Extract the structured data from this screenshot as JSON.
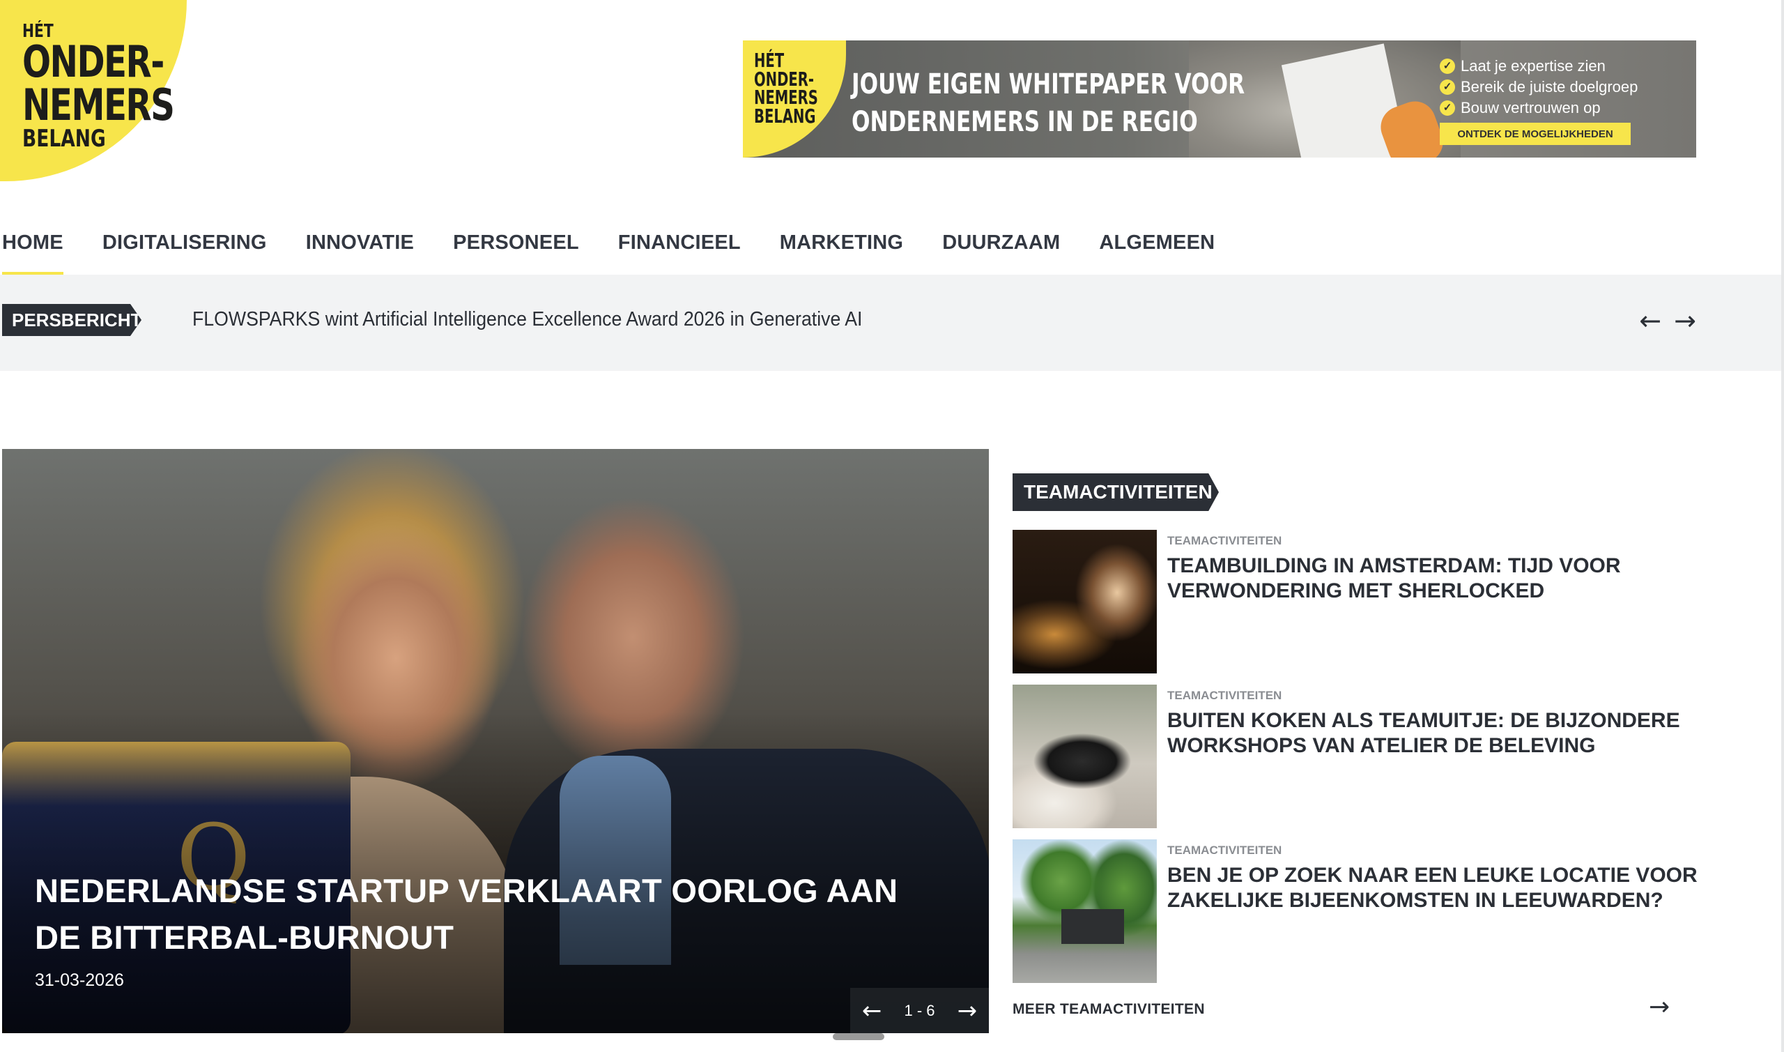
{
  "logo": {
    "line1": "HÉT",
    "line2": "ONDER-",
    "line3": "NEMERS",
    "line4": "BELANG"
  },
  "banner": {
    "logo_text": "HÉT ONDER- NEMERS BELANG",
    "headline_line1": "JOUW EIGEN WHITEPAPER VOOR",
    "headline_line2": "ONDERNEMERS IN DE REGIO",
    "bullets": [
      "Laat je expertise zien",
      "Bereik de juiste doelgroep",
      "Bouw vertrouwen op"
    ],
    "cta": "ONTDEK DE MOGELIJKHEDEN"
  },
  "nav": {
    "items": [
      "HOME",
      "DIGITALISERING",
      "INNOVATIE",
      "PERSONEEL",
      "FINANCIEEL",
      "MARKETING",
      "DUURZAAM",
      "ALGEMEEN"
    ],
    "active": "HOME"
  },
  "ticker": {
    "badge": "PERSBERICHT",
    "text": "FLOWSPARKS wint Artificial Intelligence Excellence Award 2026 in Generative AI",
    "prev_icon": "←",
    "next_icon": "→"
  },
  "hero": {
    "title": "NEDERLANDSE STARTUP VERKLAART OORLOG AAN DE BITTERBAL-BURNOUT",
    "date": "31-03-2026",
    "pager": "1 - 6",
    "prev_icon": "←",
    "next_icon": "→",
    "bag_letter": "Q"
  },
  "sidebar": {
    "section_title": "TEAMACTIVITEITEN",
    "cards": [
      {
        "category": "TEAMACTIVITEITEN",
        "title": "TEAMBUILDING IN AMSTERDAM: TIJD VOOR VERWONDERING MET SHERLOCKED"
      },
      {
        "category": "TEAMACTIVITEITEN",
        "title": "BUITEN KOKEN ALS TEAMUITJE: DE BIJZONDERE WORKSHOPS VAN ATELIER DE BELEVING"
      },
      {
        "category": "TEAMACTIVITEITEN",
        "title": "BEN JE OP ZOEK NAAR EEN LEUKE LOCATIE VOOR ZAKELIJKE BIJEENKOMSTEN IN LEEUWARDEN?"
      }
    ],
    "more_label": "MEER TEAMACTIVITEITEN",
    "more_icon": "→"
  },
  "colors": {
    "brand_yellow": "#f7e54b",
    "dark": "#2b2f36",
    "ticker_bg": "#f2f3f4"
  }
}
